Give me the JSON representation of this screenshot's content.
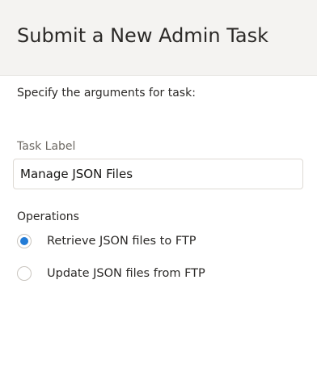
{
  "dialog": {
    "title": "Submit a New Admin Task",
    "instruction": "Specify the arguments for task:"
  },
  "task_label": {
    "label": "Task Label",
    "value": "Manage JSON Files"
  },
  "operations": {
    "label": "Operations",
    "options": [
      {
        "label": "Retrieve JSON files to FTP",
        "selected": true
      },
      {
        "label": "Update JSON files from FTP",
        "selected": false
      }
    ]
  },
  "colors": {
    "accent": "#227bd6",
    "header_bg": "#f4f3f1"
  }
}
